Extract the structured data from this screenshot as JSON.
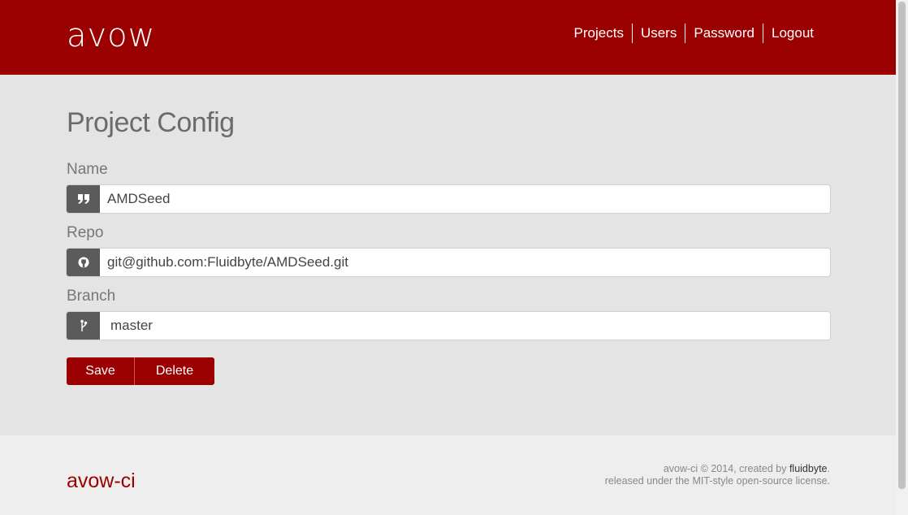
{
  "header": {
    "logo": "avow",
    "nav": [
      {
        "label": "Projects"
      },
      {
        "label": "Users"
      },
      {
        "label": "Password"
      },
      {
        "label": "Logout"
      }
    ]
  },
  "main": {
    "title": "Project Config",
    "fields": {
      "name": {
        "label": "Name",
        "value": "AMDSeed",
        "icon": "quote-icon"
      },
      "repo": {
        "label": "Repo",
        "value": "git@github.com:Fluidbyte/AMDSeed.git",
        "icon": "github-icon"
      },
      "branch": {
        "label": "Branch",
        "value": "master",
        "icon": "branch-icon"
      }
    },
    "buttons": {
      "save": "Save",
      "delete": "Delete"
    }
  },
  "footer": {
    "brand": "avow-ci",
    "line1_prefix": "avow-ci © 2014, created by ",
    "line1_link": "fluidbyte",
    "line1_suffix": ".",
    "line2": "released under the MIT-style open-source license."
  },
  "colors": {
    "brand": "#9b0000",
    "background": "#e4e4e4",
    "addon": "#5b5b5b"
  }
}
